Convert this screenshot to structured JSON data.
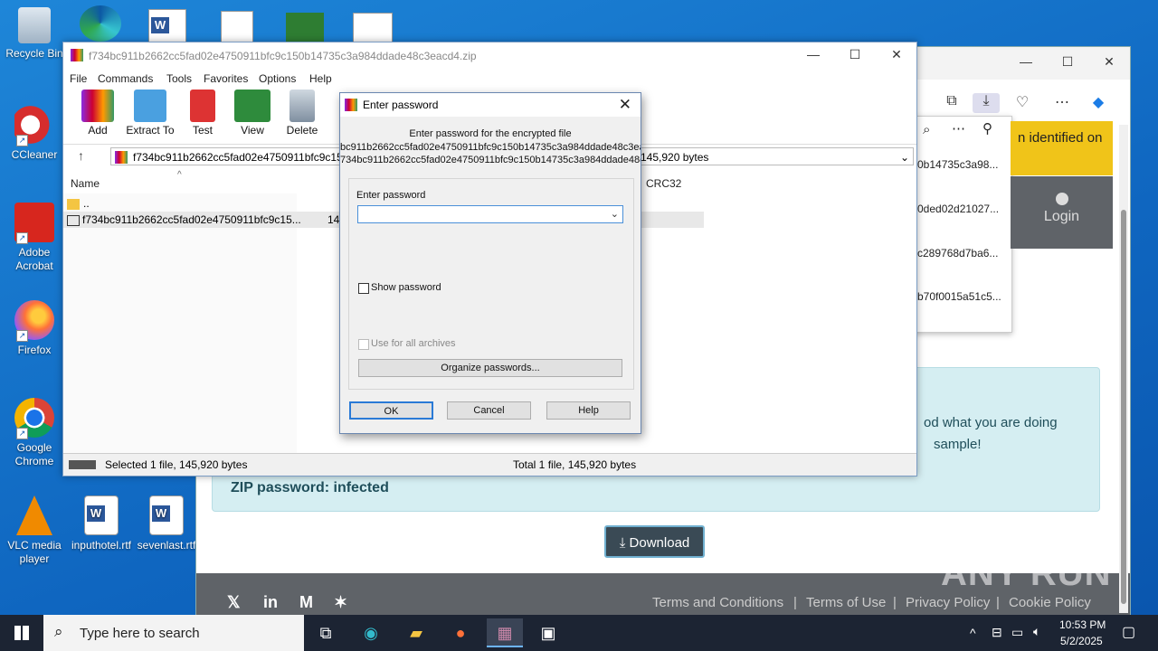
{
  "desktop_icons": [
    {
      "label": "Recycle Bin"
    },
    {
      "label": "CCleaner"
    },
    {
      "label": "Adobe Acrobat"
    },
    {
      "label": "Firefox"
    },
    {
      "label": "Google Chrome"
    },
    {
      "label": "VLC media player"
    },
    {
      "label": "inputhotel.rtf"
    },
    {
      "label": "sevenlast.rtf"
    }
  ],
  "browser": {
    "downloads": [
      "0b14735c3a98...",
      "0ded02d21027...",
      "c289768d7ba6...",
      "b70f0015a51c5..."
    ],
    "banner_text": "n identified on",
    "login_label": "Login",
    "info_line1": "od what you are doing",
    "info_line2": "sample!",
    "zip_password": "ZIP password: infected",
    "download_button": "Download",
    "footer_links": [
      "Terms and Conditions",
      "Terms of Use",
      "Privacy Policy",
      "Cookie Policy"
    ],
    "watermark": "ANY RUN"
  },
  "winrar": {
    "title": "f734bc911b2662cc5fad02e4750911bfc9c150b14735c3a984ddade48c3eacd4.zip",
    "menu": [
      "File",
      "Commands",
      "Tools",
      "Favorites",
      "Options",
      "Help"
    ],
    "toolbar": [
      "Add",
      "Extract To",
      "Test",
      "View",
      "Delete"
    ],
    "path": "f734bc911b2662cc5fad02e4750911bfc9c150",
    "path_suffix": "145,920 bytes",
    "columns": {
      "name": "Name",
      "crc": "CRC32"
    },
    "rows": [
      {
        "name": "..",
        "size": ""
      },
      {
        "name": "f734bc911b2662cc5fad02e4750911bfc9c15...",
        "size": "14"
      }
    ],
    "status_left": "Selected 1 file, 145,920 bytes",
    "status_right": "Total 1 file, 145,920 bytes"
  },
  "password_dialog": {
    "title": "Enter password",
    "caption": "Enter password for the encrypted file",
    "file_line1": "bc911b2662cc5fad02e4750911bfc9c150b14735c3a984ddade48c3ea",
    "file_line2": "734bc911b2662cc5fad02e4750911bfc9c150b14735c3a984ddade48c3",
    "enter_label": "Enter password",
    "input_value": "",
    "show_password": "Show password",
    "use_all": "Use for all archives",
    "organize": "Organize passwords...",
    "ok": "OK",
    "cancel": "Cancel",
    "help": "Help"
  },
  "taskbar": {
    "search_placeholder": "Type here to search",
    "time": "10:53 PM",
    "date": "5/2/2025"
  }
}
